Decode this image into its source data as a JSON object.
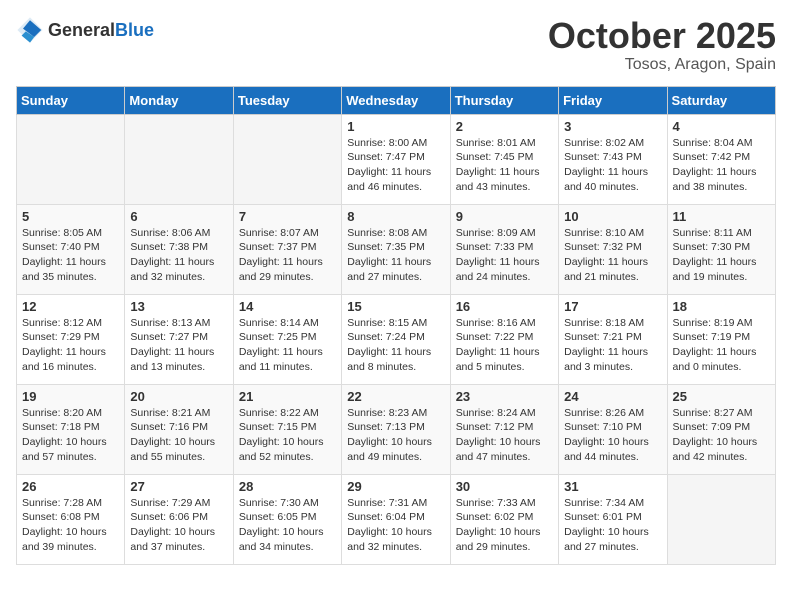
{
  "header": {
    "logo_general": "General",
    "logo_blue": "Blue",
    "month": "October 2025",
    "location": "Tosos, Aragon, Spain"
  },
  "days_of_week": [
    "Sunday",
    "Monday",
    "Tuesday",
    "Wednesday",
    "Thursday",
    "Friday",
    "Saturday"
  ],
  "weeks": [
    [
      {
        "day": "",
        "info": ""
      },
      {
        "day": "",
        "info": ""
      },
      {
        "day": "",
        "info": ""
      },
      {
        "day": "1",
        "info": "Sunrise: 8:00 AM\nSunset: 7:47 PM\nDaylight: 11 hours\nand 46 minutes."
      },
      {
        "day": "2",
        "info": "Sunrise: 8:01 AM\nSunset: 7:45 PM\nDaylight: 11 hours\nand 43 minutes."
      },
      {
        "day": "3",
        "info": "Sunrise: 8:02 AM\nSunset: 7:43 PM\nDaylight: 11 hours\nand 40 minutes."
      },
      {
        "day": "4",
        "info": "Sunrise: 8:04 AM\nSunset: 7:42 PM\nDaylight: 11 hours\nand 38 minutes."
      }
    ],
    [
      {
        "day": "5",
        "info": "Sunrise: 8:05 AM\nSunset: 7:40 PM\nDaylight: 11 hours\nand 35 minutes."
      },
      {
        "day": "6",
        "info": "Sunrise: 8:06 AM\nSunset: 7:38 PM\nDaylight: 11 hours\nand 32 minutes."
      },
      {
        "day": "7",
        "info": "Sunrise: 8:07 AM\nSunset: 7:37 PM\nDaylight: 11 hours\nand 29 minutes."
      },
      {
        "day": "8",
        "info": "Sunrise: 8:08 AM\nSunset: 7:35 PM\nDaylight: 11 hours\nand 27 minutes."
      },
      {
        "day": "9",
        "info": "Sunrise: 8:09 AM\nSunset: 7:33 PM\nDaylight: 11 hours\nand 24 minutes."
      },
      {
        "day": "10",
        "info": "Sunrise: 8:10 AM\nSunset: 7:32 PM\nDaylight: 11 hours\nand 21 minutes."
      },
      {
        "day": "11",
        "info": "Sunrise: 8:11 AM\nSunset: 7:30 PM\nDaylight: 11 hours\nand 19 minutes."
      }
    ],
    [
      {
        "day": "12",
        "info": "Sunrise: 8:12 AM\nSunset: 7:29 PM\nDaylight: 11 hours\nand 16 minutes."
      },
      {
        "day": "13",
        "info": "Sunrise: 8:13 AM\nSunset: 7:27 PM\nDaylight: 11 hours\nand 13 minutes."
      },
      {
        "day": "14",
        "info": "Sunrise: 8:14 AM\nSunset: 7:25 PM\nDaylight: 11 hours\nand 11 minutes."
      },
      {
        "day": "15",
        "info": "Sunrise: 8:15 AM\nSunset: 7:24 PM\nDaylight: 11 hours\nand 8 minutes."
      },
      {
        "day": "16",
        "info": "Sunrise: 8:16 AM\nSunset: 7:22 PM\nDaylight: 11 hours\nand 5 minutes."
      },
      {
        "day": "17",
        "info": "Sunrise: 8:18 AM\nSunset: 7:21 PM\nDaylight: 11 hours\nand 3 minutes."
      },
      {
        "day": "18",
        "info": "Sunrise: 8:19 AM\nSunset: 7:19 PM\nDaylight: 11 hours\nand 0 minutes."
      }
    ],
    [
      {
        "day": "19",
        "info": "Sunrise: 8:20 AM\nSunset: 7:18 PM\nDaylight: 10 hours\nand 57 minutes."
      },
      {
        "day": "20",
        "info": "Sunrise: 8:21 AM\nSunset: 7:16 PM\nDaylight: 10 hours\nand 55 minutes."
      },
      {
        "day": "21",
        "info": "Sunrise: 8:22 AM\nSunset: 7:15 PM\nDaylight: 10 hours\nand 52 minutes."
      },
      {
        "day": "22",
        "info": "Sunrise: 8:23 AM\nSunset: 7:13 PM\nDaylight: 10 hours\nand 49 minutes."
      },
      {
        "day": "23",
        "info": "Sunrise: 8:24 AM\nSunset: 7:12 PM\nDaylight: 10 hours\nand 47 minutes."
      },
      {
        "day": "24",
        "info": "Sunrise: 8:26 AM\nSunset: 7:10 PM\nDaylight: 10 hours\nand 44 minutes."
      },
      {
        "day": "25",
        "info": "Sunrise: 8:27 AM\nSunset: 7:09 PM\nDaylight: 10 hours\nand 42 minutes."
      }
    ],
    [
      {
        "day": "26",
        "info": "Sunrise: 7:28 AM\nSunset: 6:08 PM\nDaylight: 10 hours\nand 39 minutes."
      },
      {
        "day": "27",
        "info": "Sunrise: 7:29 AM\nSunset: 6:06 PM\nDaylight: 10 hours\nand 37 minutes."
      },
      {
        "day": "28",
        "info": "Sunrise: 7:30 AM\nSunset: 6:05 PM\nDaylight: 10 hours\nand 34 minutes."
      },
      {
        "day": "29",
        "info": "Sunrise: 7:31 AM\nSunset: 6:04 PM\nDaylight: 10 hours\nand 32 minutes."
      },
      {
        "day": "30",
        "info": "Sunrise: 7:33 AM\nSunset: 6:02 PM\nDaylight: 10 hours\nand 29 minutes."
      },
      {
        "day": "31",
        "info": "Sunrise: 7:34 AM\nSunset: 6:01 PM\nDaylight: 10 hours\nand 27 minutes."
      },
      {
        "day": "",
        "info": ""
      }
    ]
  ]
}
